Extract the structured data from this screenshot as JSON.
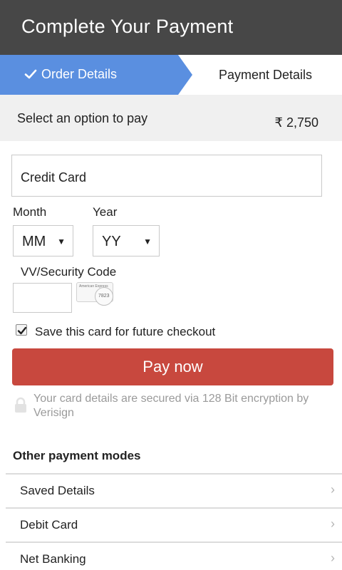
{
  "header": {
    "title": "Complete Your Payment"
  },
  "steps": [
    {
      "label": "Order Details",
      "state": "completed",
      "icon": "check-icon"
    },
    {
      "label": "Payment Details",
      "state": "current"
    }
  ],
  "amount": {
    "label": "Select an option to pay",
    "value": "₹ 2,750"
  },
  "payment_method": {
    "value": "Credit Card"
  },
  "expiry": {
    "month_label": "Month",
    "month_value": "MM",
    "year_label": "Year",
    "year_value": "YY"
  },
  "cvv": {
    "label": "VV/Security Code",
    "hint_brand": "American Express",
    "hint_digits": "7823"
  },
  "save_card": {
    "label": "Save this card for future checkout",
    "checked": true
  },
  "pay_button": {
    "label": "Pay now"
  },
  "security_note": "Your card details are secured via 128 Bit encryption by Verisign",
  "other_modes": {
    "title": "Other payment modes",
    "items": [
      {
        "label": "Saved Details"
      },
      {
        "label": "Debit Card"
      },
      {
        "label": "Net Banking"
      }
    ]
  },
  "colors": {
    "header_bg": "#474747",
    "step_active": "#5a8fe0",
    "pay_button": "#c8483e",
    "amount_bar": "#f0f0f0"
  }
}
